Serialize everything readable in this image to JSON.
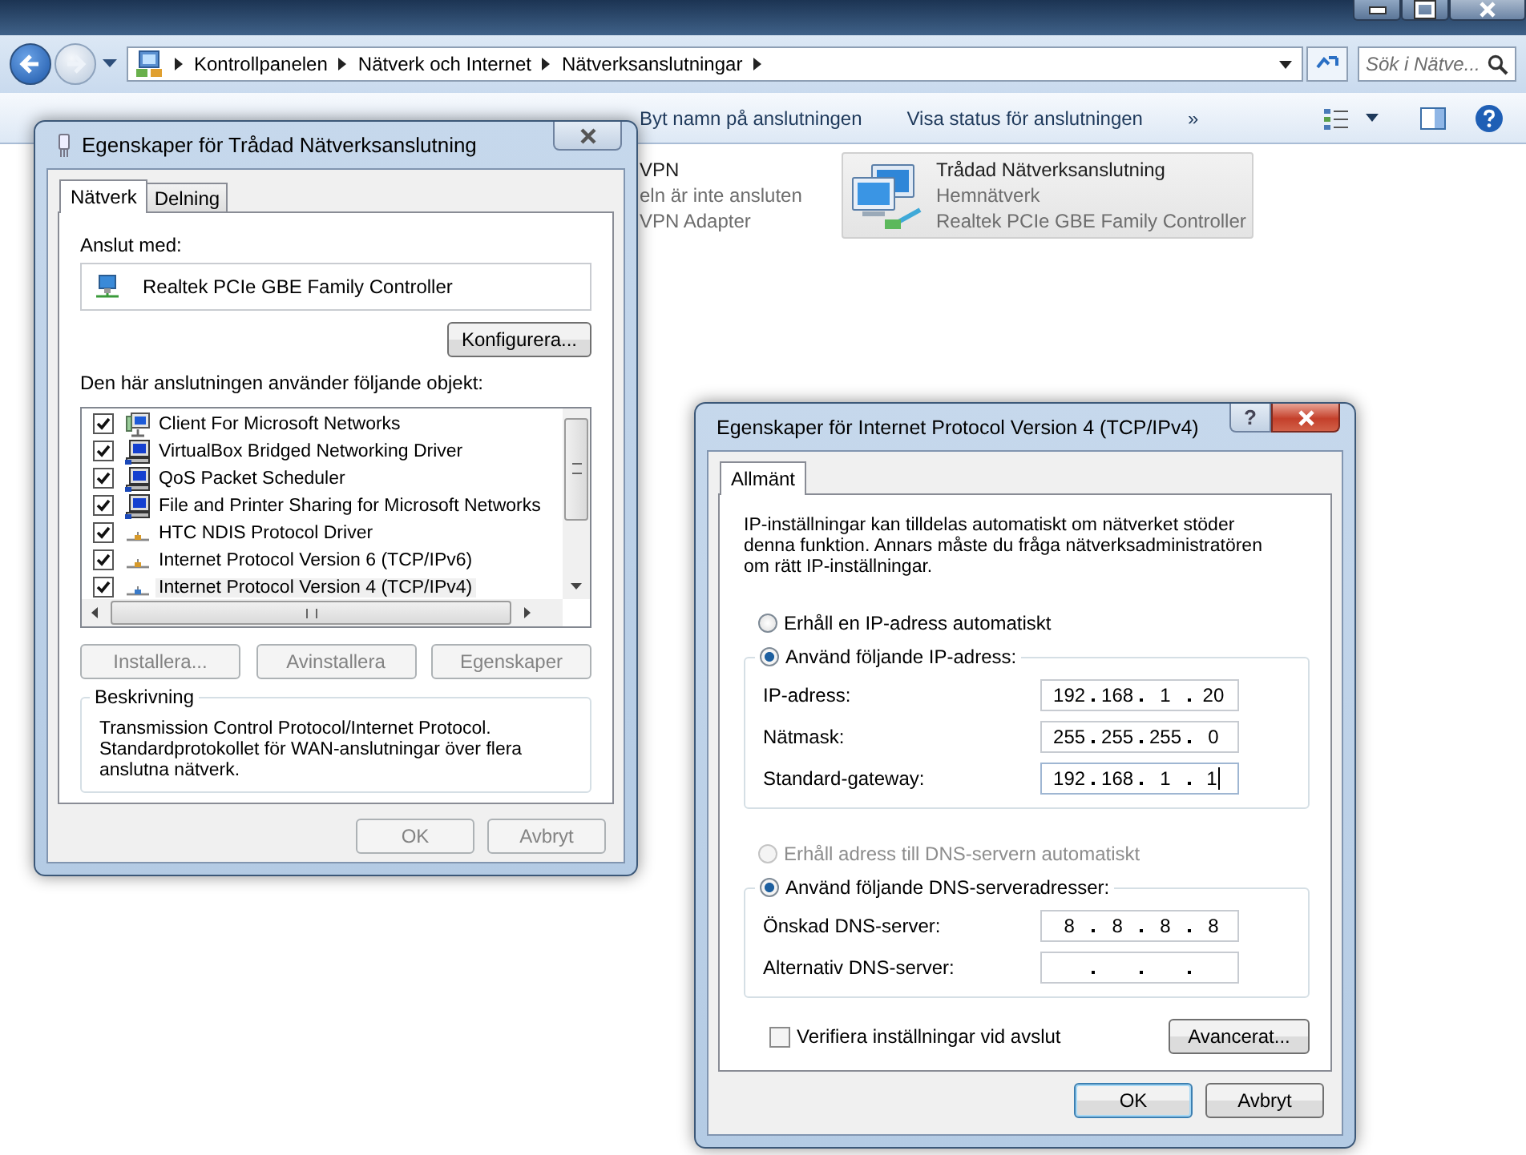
{
  "explorer": {
    "breadcrumb": [
      "Kontrollpanelen",
      "Nätverk och Internet",
      "Nätverksanslutningar"
    ],
    "search": {
      "placeholder": "Sök i Nätve..."
    },
    "toolbar": [
      {
        "label": "Byt namn på anslutningen"
      },
      {
        "label": "Visa status för anslutningen"
      },
      {
        "label": "»"
      }
    ],
    "connections": [
      {
        "kind": "hidden",
        "name": "VPN",
        "status": "eln är inte ansluten",
        "device": "VPN Adapter",
        "hovered": false
      },
      {
        "kind": "ethernet",
        "name": "Trådad Nätverksanslutning",
        "status": "Hemnätverk",
        "device": "Realtek PCIe GBE Family Controller",
        "hovered": true
      }
    ]
  },
  "network_dialog": {
    "title": "Egenskaper för Trådad Nätverksanslutning",
    "tabs": [
      {
        "label": "Nätverk",
        "selected": true
      },
      {
        "label": "Delning",
        "selected": false
      }
    ],
    "connect_label": "Anslut med:",
    "adapter": "Realtek PCIe GBE Family Controller",
    "configure_button": "Konfigurera...",
    "items_label": "Den här anslutningen använder följande objekt:",
    "items": [
      {
        "label": "Client For Microsoft Networks",
        "kind": "client",
        "checked": true,
        "selected": false
      },
      {
        "label": "VirtualBox Bridged Networking Driver",
        "kind": "service",
        "checked": true,
        "selected": false
      },
      {
        "label": "QoS Packet Scheduler",
        "kind": "service",
        "checked": true,
        "selected": false
      },
      {
        "label": "File and Printer Sharing for Microsoft Networks",
        "kind": "service",
        "checked": true,
        "selected": false
      },
      {
        "label": "HTC NDIS Protocol Driver",
        "kind": "protocol",
        "checked": true,
        "selected": false
      },
      {
        "label": "Internet Protocol Version 6 (TCP/IPv6)",
        "kind": "protocol",
        "checked": true,
        "selected": false
      },
      {
        "label": "Internet Protocol Version 4 (TCP/IPv4)",
        "kind": "protocol",
        "checked": true,
        "selected": true
      }
    ],
    "item_buttons": [
      {
        "label": "Installera...",
        "disabled": true
      },
      {
        "label": "Avinstallera",
        "disabled": true
      },
      {
        "label": "Egenskaper",
        "disabled": true
      }
    ],
    "description": {
      "title": "Beskrivning",
      "text": "Transmission Control Protocol/Internet Protocol.\nStandardprotokollet för WAN-anslutningar över flera anslutna nätverk."
    },
    "buttons": [
      {
        "label": "OK",
        "disabled": true,
        "default": false
      },
      {
        "label": "Avbryt",
        "disabled": true,
        "default": false
      }
    ]
  },
  "ipv4_dialog": {
    "title": "Egenskaper för Internet Protocol Version 4 (TCP/IPv4)",
    "help_button": "?",
    "tabs": [
      {
        "label": "Allmänt",
        "selected": true
      }
    ],
    "intro": "IP-inställningar kan tilldelas automatiskt om nätverket stöder denna funktion. Annars måste du fråga nätverksadministratören om rätt IP-inställningar.",
    "ip_options": [
      {
        "label": "Erhåll en IP-adress automatiskt",
        "selected": false,
        "disabled": false
      },
      {
        "label": "Använd följande IP-adress:",
        "selected": true,
        "disabled": false
      }
    ],
    "ip_fields": [
      {
        "label": "IP-adress:",
        "octets": [
          "192",
          "168",
          "1",
          "20"
        ],
        "focused": false
      },
      {
        "label": "Nätmask:",
        "octets": [
          "255",
          "255",
          "255",
          "0"
        ],
        "focused": false
      },
      {
        "label": "Standard-gateway:",
        "octets": [
          "192",
          "168",
          "1",
          "1"
        ],
        "focused": true
      }
    ],
    "dns_options": [
      {
        "label": "Erhåll adress till DNS-servern automatiskt",
        "selected": false,
        "disabled": true
      },
      {
        "label": "Använd följande DNS-serveradresser:",
        "selected": true,
        "disabled": false
      }
    ],
    "dns_fields": [
      {
        "label": "Önskad DNS-server:",
        "octets": [
          "8",
          "8",
          "8",
          "8"
        ],
        "focused": false
      },
      {
        "label": "Alternativ DNS-server:",
        "focused": false
      }
    ],
    "verify": {
      "label": "Verifiera inställningar vid avslut",
      "checked": false
    },
    "advanced_button": "Avancerat...",
    "buttons": [
      {
        "label": "OK",
        "disabled": false,
        "default": true
      },
      {
        "label": "Avbryt",
        "disabled": false,
        "default": false
      }
    ]
  }
}
